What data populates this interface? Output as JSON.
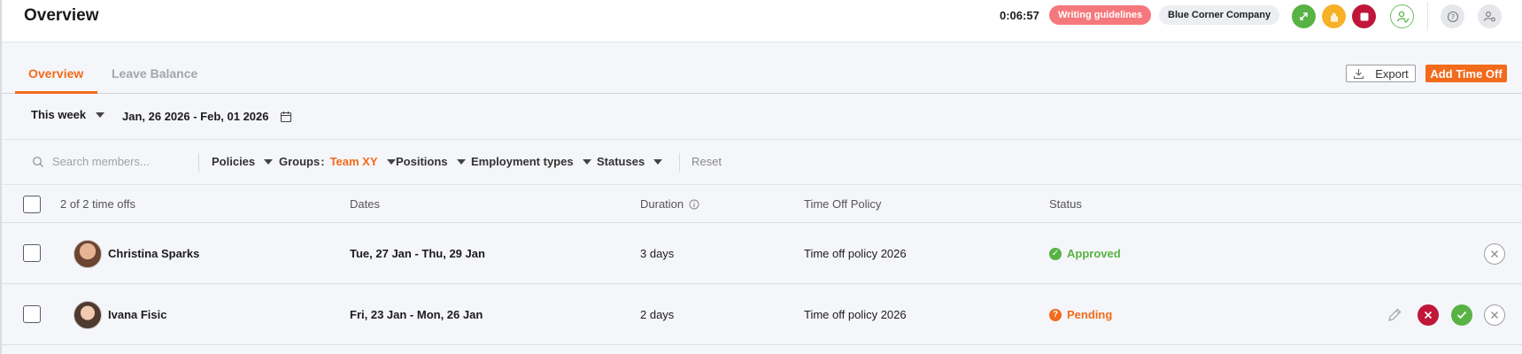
{
  "header": {
    "title": "Overview",
    "timer": "0:06:57",
    "guidelines_label": "Writing guidelines",
    "company_label": "Blue Corner Company"
  },
  "tabs": [
    {
      "label": "Overview",
      "active": true
    },
    {
      "label": "Leave Balance",
      "active": false
    }
  ],
  "actions": {
    "export_label": "Export",
    "add_label": "Add Time Off"
  },
  "period": {
    "selector": "This week",
    "range": "Jan, 26 2026 - Feb, 01 2026"
  },
  "filters": {
    "search_placeholder": "Search members...",
    "policies": "Policies",
    "groups": "Groups",
    "groups_separator": ":",
    "groups_value": "Team XY",
    "positions": "Positions",
    "employment_types": "Employment types",
    "statuses": "Statuses",
    "reset": "Reset"
  },
  "table": {
    "count_label": "2 of 2 time offs",
    "columns": {
      "dates": "Dates",
      "duration": "Duration",
      "policy": "Time Off Policy",
      "status": "Status"
    },
    "rows": [
      {
        "name": "Christina Sparks",
        "dates": "Tue, 27 Jan - Thu, 29 Jan",
        "duration": "3 days",
        "policy": "Time off policy 2026",
        "status": "Approved"
      },
      {
        "name": "Ivana Fisic",
        "dates": "Fri, 23 Jan - Mon, 26 Jan",
        "duration": "2 days",
        "policy": "Time off policy 2026",
        "status": "Pending"
      }
    ]
  },
  "colors": {
    "accent": "#f26a1b",
    "approved": "#57b344",
    "reject": "#c0163a",
    "guidelines": "#f5787c"
  }
}
